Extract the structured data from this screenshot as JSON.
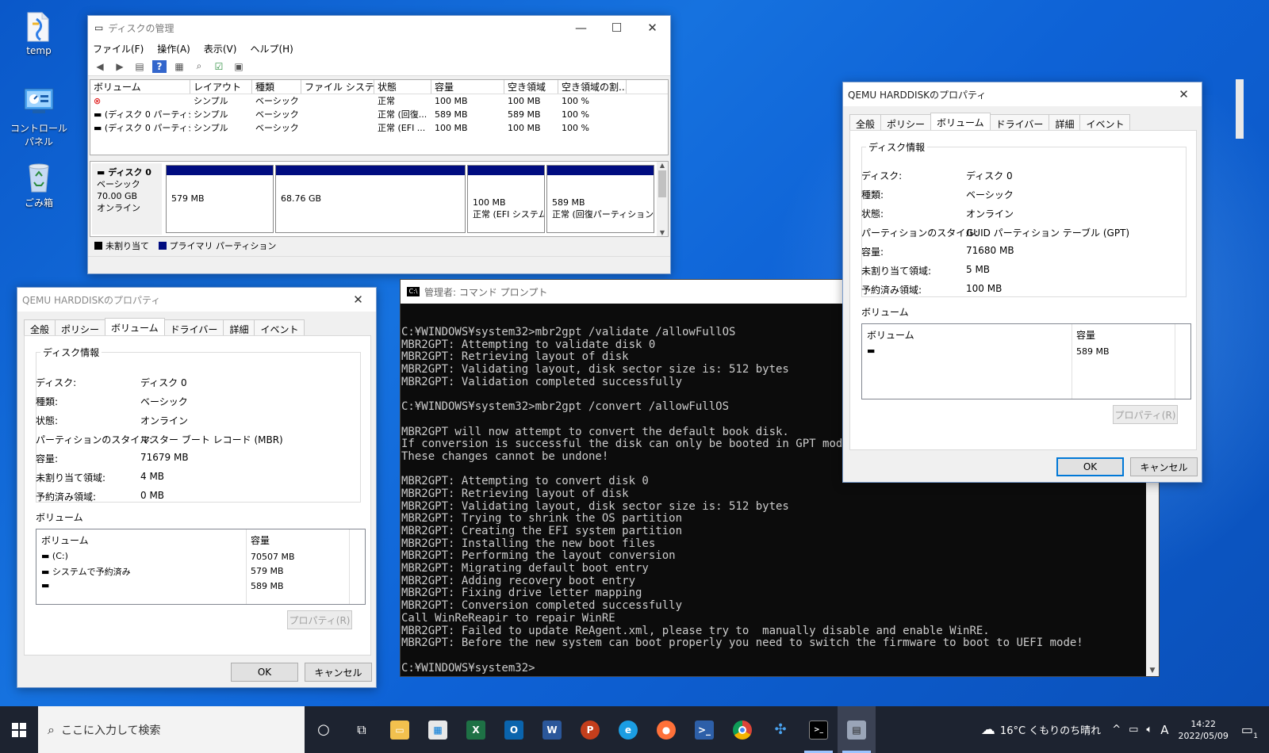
{
  "desktop": {
    "icons": [
      {
        "label": "temp",
        "icon": "folder-icon"
      },
      {
        "label": "コントロール パネル",
        "icon": "control-panel-icon"
      },
      {
        "label": "ごみ箱",
        "icon": "recycle-bin-icon"
      }
    ]
  },
  "diskmgmt": {
    "title": "ディスクの管理",
    "menu": [
      "ファイル(F)",
      "操作(A)",
      "表示(V)",
      "ヘルプ(H)"
    ],
    "columns": [
      "ボリューム",
      "レイアウト",
      "種類",
      "ファイル システム",
      "状態",
      "容量",
      "空き領域",
      "空き領域の割..."
    ],
    "rows": [
      [
        "",
        "シンプル",
        "ベーシック",
        "",
        "正常",
        "100 MB",
        "100 MB",
        "100 %"
      ],
      [
        "(ディスク 0 パーティシ...",
        "シンプル",
        "ベーシック",
        "",
        "正常 (回復...",
        "589 MB",
        "589 MB",
        "100 %"
      ],
      [
        "(ディスク 0 パーティシ...",
        "シンプル",
        "ベーシック",
        "",
        "正常 (EFI ...",
        "100 MB",
        "100 MB",
        "100 %"
      ]
    ],
    "disk": {
      "name": "ディスク 0",
      "type": "ベーシック",
      "size": "70.00 GB",
      "status": "オンライン"
    },
    "partitions": [
      {
        "size": "579 MB",
        "status": ""
      },
      {
        "size": "68.76 GB",
        "status": ""
      },
      {
        "size": "100 MB",
        "status": "正常 (EFI システム"
      },
      {
        "size": "589 MB",
        "status": "正常 (回復パーティション)"
      }
    ],
    "legend": {
      "unallocated": "未割り当て",
      "primary": "プライマリ パーティション"
    }
  },
  "props_left": {
    "title": "QEMU HARDDISKのプロパティ",
    "tabs": [
      "全般",
      "ポリシー",
      "ボリューム",
      "ドライバー",
      "詳細",
      "イベント"
    ],
    "group_label": "ディスク情報",
    "info": [
      [
        "ディスク:",
        "ディスク 0"
      ],
      [
        "種類:",
        "ベーシック"
      ],
      [
        "状態:",
        "オンライン"
      ],
      [
        "パーティションのスタイル:",
        "マスター ブート レコード (MBR)"
      ],
      [
        "容量:",
        "71679 MB"
      ],
      [
        "未割り当て領域:",
        "4 MB"
      ],
      [
        "予約済み領域:",
        "0 MB"
      ]
    ],
    "volumes_label": "ボリューム",
    "vol_cols": [
      "ボリューム",
      "容量"
    ],
    "volumes": [
      [
        "(C:)",
        "70507 MB"
      ],
      [
        "システムで予約済み",
        "579 MB"
      ],
      [
        "",
        "589 MB"
      ]
    ],
    "prop_btn": "プロパティ(R)",
    "ok": "OK",
    "cancel": "キャンセル"
  },
  "props_right": {
    "title": "QEMU HARDDISKのプロパティ",
    "tabs": [
      "全般",
      "ポリシー",
      "ボリューム",
      "ドライバー",
      "詳細",
      "イベント"
    ],
    "group_label": "ディスク情報",
    "info": [
      [
        "ディスク:",
        "ディスク 0"
      ],
      [
        "種類:",
        "ベーシック"
      ],
      [
        "状態:",
        "オンライン"
      ],
      [
        "パーティションのスタイル:",
        "GUID パーティション テーブル (GPT)"
      ],
      [
        "容量:",
        "71680 MB"
      ],
      [
        "未割り当て領域:",
        "5 MB"
      ],
      [
        "予約済み領域:",
        "100 MB"
      ]
    ],
    "volumes_label": "ボリューム",
    "vol_cols": [
      "ボリューム",
      "容量"
    ],
    "volumes": [
      [
        "",
        "589 MB"
      ]
    ],
    "prop_btn": "プロパティ(R)",
    "ok": "OK",
    "cancel": "キャンセル"
  },
  "cmd": {
    "title": "管理者: コマンド プロンプト",
    "lines": [
      "C:¥WINDOWS¥system32>mbr2gpt /validate /allowFullOS",
      "MBR2GPT: Attempting to validate disk 0",
      "MBR2GPT: Retrieving layout of disk",
      "MBR2GPT: Validating layout, disk sector size is: 512 bytes",
      "MBR2GPT: Validation completed successfully",
      "",
      "C:¥WINDOWS¥system32>mbr2gpt /convert /allowFullOS",
      "",
      "MBR2GPT will now attempt to convert the default book disk.",
      "If conversion is successful the disk can only be booted in GPT mode.",
      "These changes cannot be undone!",
      "",
      "MBR2GPT: Attempting to convert disk 0",
      "MBR2GPT: Retrieving layout of disk",
      "MBR2GPT: Validating layout, disk sector size is: 512 bytes",
      "MBR2GPT: Trying to shrink the OS partition",
      "MBR2GPT: Creating the EFI system partition",
      "MBR2GPT: Installing the new boot files",
      "MBR2GPT: Performing the layout conversion",
      "MBR2GPT: Migrating default boot entry",
      "MBR2GPT: Adding recovery boot entry",
      "MBR2GPT: Fixing drive letter mapping",
      "MBR2GPT: Conversion completed successfully",
      "Call WinReReapir to repair WinRE",
      "MBR2GPT: Failed to update ReAgent.xml, please try to  manually disable and enable WinRE.",
      "MBR2GPT: Before the new system can boot properly you need to switch the firmware to boot to UEFI mode!",
      "",
      "C:¥WINDOWS¥system32>"
    ]
  },
  "taskbar": {
    "search_placeholder": "ここに入力して検索",
    "weather": "16°C くもりのち晴れ",
    "ime": "A",
    "time": "14:22",
    "date": "2022/05/09",
    "notif_count": "1"
  }
}
